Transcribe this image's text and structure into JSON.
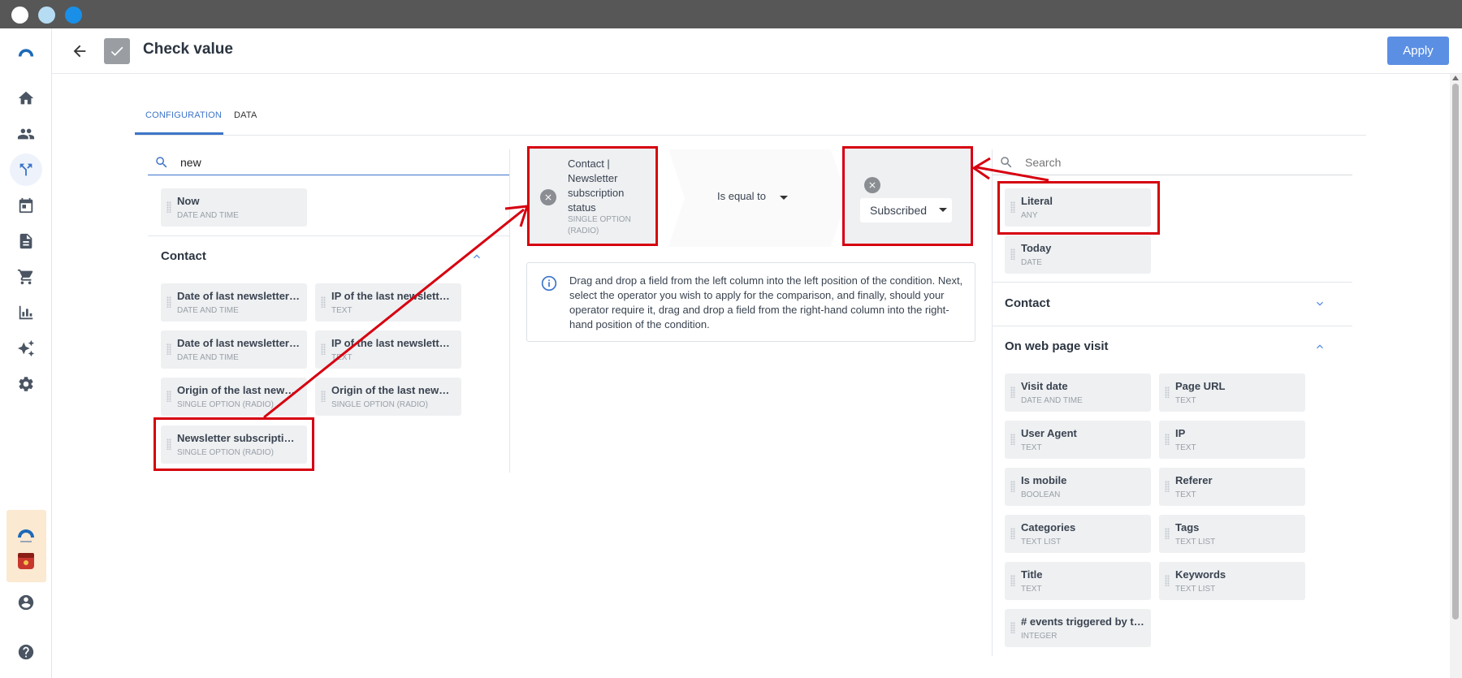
{
  "window": {
    "dots": [
      "#ffffff",
      "#b5dcf3",
      "#1a8fe8"
    ]
  },
  "rail": {
    "items": [
      "logo-icon",
      "home-icon",
      "contacts-icon",
      "workflows-icon",
      "calendar-icon",
      "document-icon",
      "cart-icon",
      "reports-icon",
      "ai-sparkle-icon",
      "settings-icon",
      "account-icon",
      "help-icon"
    ]
  },
  "header": {
    "title": "Check value",
    "apply_label": "Apply"
  },
  "tabs": [
    "CONFIGURATION",
    "DATA"
  ],
  "left_panel": {
    "search_value": "new",
    "top_fields": [
      {
        "name": "Now",
        "type": "DATE AND TIME"
      }
    ],
    "groups": [
      {
        "title": "Contact",
        "fields": [
          {
            "name": "Date of last newsletter…",
            "type": "DATE AND TIME"
          },
          {
            "name": "IP of the last newslette…",
            "type": "TEXT"
          },
          {
            "name": "Date of last newsletter…",
            "type": "DATE AND TIME"
          },
          {
            "name": "IP of the last newslette…",
            "type": "TEXT"
          },
          {
            "name": "Origin of the last news…",
            "type": "SINGLE OPTION (RADIO)"
          },
          {
            "name": "Origin of the last news…",
            "type": "SINGLE OPTION (RADIO)"
          },
          {
            "name": "Newsletter subscriptio…",
            "type": "SINGLE OPTION (RADIO)"
          }
        ]
      }
    ]
  },
  "condition": {
    "left_field": "Contact | Newsletter subscription status",
    "left_type": "SINGLE OPTION (RADIO)",
    "operator": "Is equal to",
    "right_value": "Subscribed"
  },
  "info_text": "Drag and drop a field from the left column into the left position of the condition. Next, select the operator you wish to apply for the comparison, and finally, should your operator require it, drag and drop a field from the right-hand column into the right-hand position of the condition.",
  "right_panel": {
    "search_placeholder": "Search",
    "top_fields": [
      {
        "name": "Literal",
        "type": "ANY"
      },
      {
        "name": "Today",
        "type": "DATE"
      }
    ],
    "groups": [
      {
        "title": "Contact",
        "fields": []
      },
      {
        "title": "On web page visit",
        "fields": [
          {
            "name": "Visit date",
            "type": "DATE AND TIME"
          },
          {
            "name": "Page URL",
            "type": "TEXT"
          },
          {
            "name": "User Agent",
            "type": "TEXT"
          },
          {
            "name": "IP",
            "type": "TEXT"
          },
          {
            "name": "Is mobile",
            "type": "BOOLEAN"
          },
          {
            "name": "Referer",
            "type": "TEXT"
          },
          {
            "name": "Categories",
            "type": "TEXT LIST"
          },
          {
            "name": "Tags",
            "type": "TEXT LIST"
          },
          {
            "name": "Title",
            "type": "TEXT"
          },
          {
            "name": "Keywords",
            "type": "TEXT LIST"
          },
          {
            "name": "# events triggered by t…",
            "type": "INTEGER"
          }
        ]
      }
    ]
  },
  "colors": {
    "accent": "#3d74c9",
    "apply": "#5b8fe3",
    "annotation": "#d6000f"
  }
}
